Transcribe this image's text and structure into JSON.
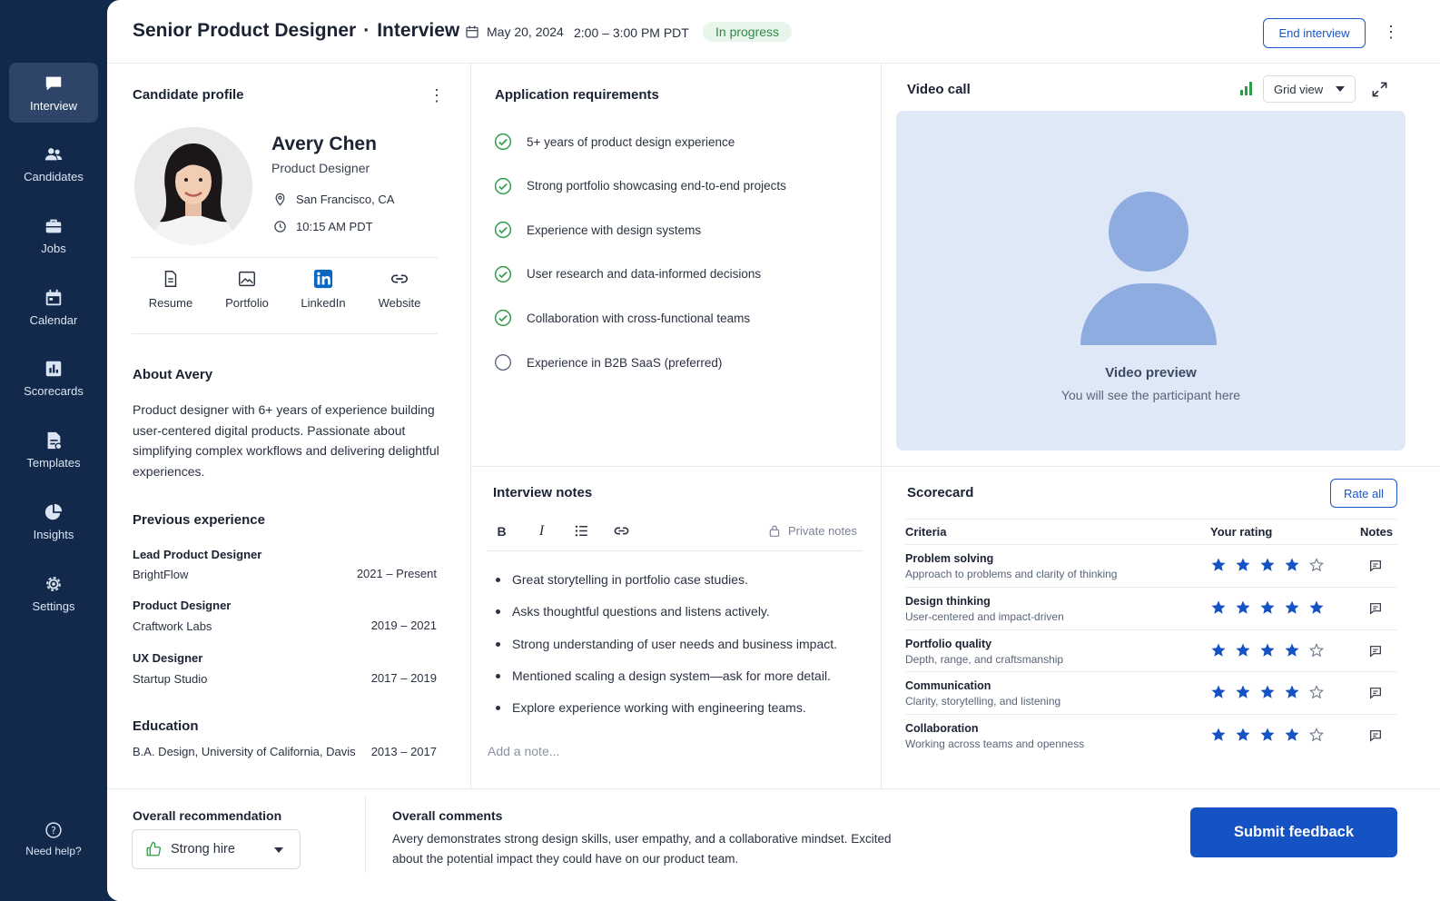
{
  "nav": {
    "items": [
      {
        "label": "Interview",
        "icon": "chat-icon"
      },
      {
        "label": "Candidates",
        "icon": "people-icon"
      },
      {
        "label": "Jobs",
        "icon": "briefcase-icon"
      },
      {
        "label": "Calendar",
        "icon": "calendar-icon"
      },
      {
        "label": "Scorecards",
        "icon": "chart-icon"
      },
      {
        "label": "Templates",
        "icon": "document-icon"
      },
      {
        "label": "Insights",
        "icon": "pie-icon"
      },
      {
        "label": "Settings",
        "icon": "gear-icon"
      }
    ],
    "help_label": "Need help?"
  },
  "header": {
    "role": "Senior Product Designer",
    "separator": "·",
    "type": "Interview",
    "date": "May 20, 2024",
    "time": "2:00 – 3:00 PM PDT",
    "status": "In progress",
    "end_label": "End interview"
  },
  "candidate": {
    "section_title": "Candidate profile",
    "name": "Avery Chen",
    "role": "Product Designer",
    "location": "San Francisco, CA",
    "local_time": "10:15 AM PDT",
    "links": [
      "Resume",
      "Portfolio",
      "LinkedIn",
      "Website"
    ],
    "about_title": "About Avery",
    "about_text": "Product designer with 6+ years of experience building user-centered digital products. Passionate about simplifying complex workflows and delivering delightful experiences.",
    "experience_title": "Previous experience",
    "experience": [
      {
        "title": "Lead Product Designer",
        "company": "BrightFlow",
        "years": "2021 – Present"
      },
      {
        "title": "Product Designer",
        "company": "Craftwork Labs",
        "years": "2019 – 2021"
      },
      {
        "title": "UX Designer",
        "company": "Startup Studio",
        "years": "2017 – 2019"
      }
    ],
    "education_title": "Education",
    "education": {
      "degree": "B.A. Design, University of California, Davis",
      "years": "2013 – 2017"
    }
  },
  "requirements": {
    "title": "Application requirements",
    "items": [
      {
        "label": "5+ years of product design experience",
        "met": true
      },
      {
        "label": "Strong portfolio showcasing end-to-end projects",
        "met": true
      },
      {
        "label": "Experience with design systems",
        "met": true
      },
      {
        "label": "User research and data-informed decisions",
        "met": true
      },
      {
        "label": "Collaboration with cross-functional teams",
        "met": true
      },
      {
        "label": "Experience in B2B SaaS (preferred)",
        "met": false
      }
    ]
  },
  "video": {
    "title": "Video call",
    "view_label": "Grid view",
    "preview_title": "Video preview",
    "preview_sub": "You will see the participant here"
  },
  "notes": {
    "title": "Interview notes",
    "private_label": "Private notes",
    "items": [
      "Great storytelling in portfolio case studies.",
      "Asks thoughtful questions and listens actively.",
      "Strong understanding of user needs and business impact.",
      "Mentioned scaling a design system—ask for more detail.",
      "Explore experience working with engineering teams."
    ],
    "placeholder": "Add a note..."
  },
  "scorecard": {
    "title": "Scorecard",
    "rate_all_label": "Rate all",
    "headers": {
      "criteria": "Criteria",
      "rating": "Your rating",
      "notes": "Notes"
    },
    "rows": [
      {
        "name": "Problem solving",
        "desc": "Approach to problems and clarity of thinking",
        "rating": 4
      },
      {
        "name": "Design thinking",
        "desc": "User-centered and impact-driven",
        "rating": 5
      },
      {
        "name": "Portfolio quality",
        "desc": "Depth, range, and craftsmanship",
        "rating": 4
      },
      {
        "name": "Communication",
        "desc": "Clarity, storytelling, and listening",
        "rating": 4
      },
      {
        "name": "Collaboration",
        "desc": "Working across teams and openness",
        "rating": 4
      }
    ],
    "max_rating": 5
  },
  "footer": {
    "rec_label": "Overall recommendation",
    "rec_value": "Strong hire",
    "comments_label": "Overall comments",
    "comments_text": "Avery demonstrates strong design skills, user empathy, and a collaborative mindset. Excited about the potential impact they could have on our product team.",
    "submit_label": "Submit feedback"
  },
  "colors": {
    "accent": "#1552c4",
    "sidebar": "#13294b",
    "success": "#2f9c4a",
    "star": "#1552c4"
  }
}
